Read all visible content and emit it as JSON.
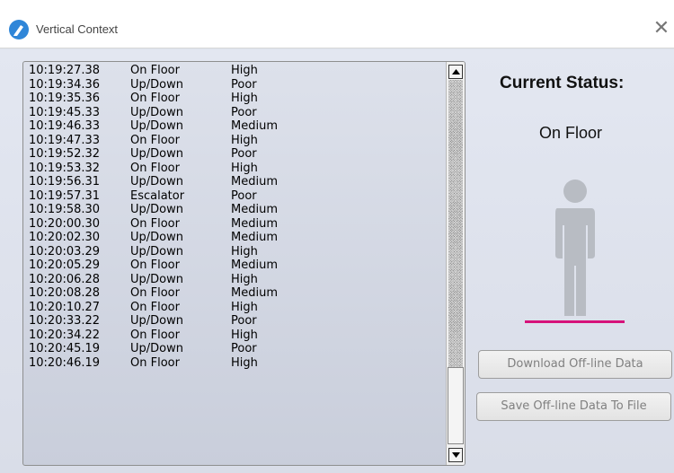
{
  "window": {
    "title": "Vertical Context",
    "close_glyph": "✕"
  },
  "log": {
    "rows": [
      {
        "time": "10:19:27.38",
        "context": "On Floor",
        "quality": "High"
      },
      {
        "time": "10:19:34.36",
        "context": "Up/Down",
        "quality": "Poor"
      },
      {
        "time": "10:19:35.36",
        "context": "On Floor",
        "quality": "High"
      },
      {
        "time": "10:19:45.33",
        "context": "Up/Down",
        "quality": "Poor"
      },
      {
        "time": "10:19:46.33",
        "context": "Up/Down",
        "quality": "Medium"
      },
      {
        "time": "10:19:47.33",
        "context": "On Floor",
        "quality": "High"
      },
      {
        "time": "10:19:52.32",
        "context": "Up/Down",
        "quality": "Poor"
      },
      {
        "time": "10:19:53.32",
        "context": "On Floor",
        "quality": "High"
      },
      {
        "time": "10:19:56.31",
        "context": "Up/Down",
        "quality": "Medium"
      },
      {
        "time": "10:19:57.31",
        "context": "Escalator",
        "quality": "Poor"
      },
      {
        "time": "10:19:58.30",
        "context": "Up/Down",
        "quality": "Medium"
      },
      {
        "time": "10:20:00.30",
        "context": "On Floor",
        "quality": "Medium"
      },
      {
        "time": "10:20:02.30",
        "context": "Up/Down",
        "quality": "Medium"
      },
      {
        "time": "10:20:03.29",
        "context": "Up/Down",
        "quality": "High"
      },
      {
        "time": "10:20:05.29",
        "context": "On Floor",
        "quality": "Medium"
      },
      {
        "time": "10:20:06.28",
        "context": "Up/Down",
        "quality": "High"
      },
      {
        "time": "10:20:08.28",
        "context": "On Floor",
        "quality": "Medium"
      },
      {
        "time": "10:20:10.27",
        "context": "On Floor",
        "quality": "High"
      },
      {
        "time": "10:20:33.22",
        "context": "Up/Down",
        "quality": "Poor"
      },
      {
        "time": "10:20:34.22",
        "context": "On Floor",
        "quality": "High"
      },
      {
        "time": "10:20:45.19",
        "context": "Up/Down",
        "quality": "Poor"
      },
      {
        "time": "10:20:46.19",
        "context": "On Floor",
        "quality": "High"
      }
    ]
  },
  "status": {
    "heading": "Current Status:",
    "value": "On Floor",
    "icon": "person-standing-icon",
    "floor_color": "#d6127a"
  },
  "buttons": {
    "download_label": "Download Off-line Data",
    "save_label": "Save Off-line Data To File"
  }
}
